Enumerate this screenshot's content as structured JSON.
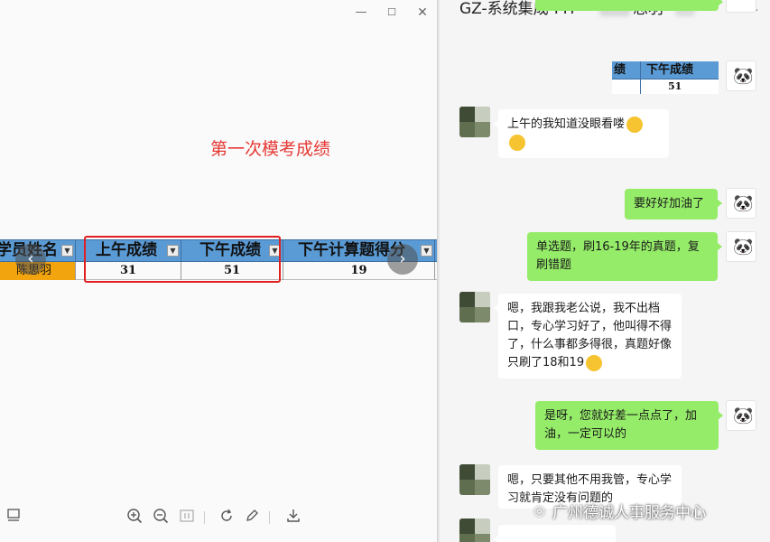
{
  "viewer": {
    "controls": {
      "minimize": "—",
      "maximize": "☐",
      "close": "✕"
    },
    "caption": "第一次模考成绩",
    "table": {
      "headers": [
        "学员姓名",
        "上午成绩",
        "下午成绩",
        "下午计算题得分"
      ],
      "row": {
        "name": "陈思羽",
        "morning": "31",
        "afternoon": "51",
        "calc": "19"
      }
    },
    "toolbar_icons": [
      "layout-icon",
      "zoom-in-icon",
      "zoom-out-icon",
      "fit-icon",
      "rotate-icon",
      "edit-icon",
      "download-icon"
    ]
  },
  "chat": {
    "title": "GZ-系统集成-FH",
    "title_tail": "思羽",
    "thumbnail": {
      "col1": "绩",
      "col2": "下午成绩",
      "value": "51"
    },
    "messages": [
      {
        "from": "other",
        "text": "上午的我知道没眼看喽"
      },
      {
        "from": "self",
        "text": "要好好加油了"
      },
      {
        "from": "self",
        "text": "单选题，刷16-19年的真题，复刷错题"
      },
      {
        "from": "other",
        "text": "嗯，我跟我老公说，我不出档口，专心学习好了，他叫得不得了，什么事都多得很，真题好像只刷了18和19"
      },
      {
        "from": "self",
        "text": "是呀，您就好差一点点了，加油，一定可以的"
      },
      {
        "from": "other",
        "text": "嗯，只要其他不用我管，专心学习就肯定没有问题的"
      }
    ],
    "watermark": "广州德诚人事服务中心"
  },
  "colors": {
    "header_blue": "#5b9bd5",
    "name_orange": "#f2a40e",
    "bubble_green": "#95ec69",
    "caption_red": "#e53935"
  }
}
